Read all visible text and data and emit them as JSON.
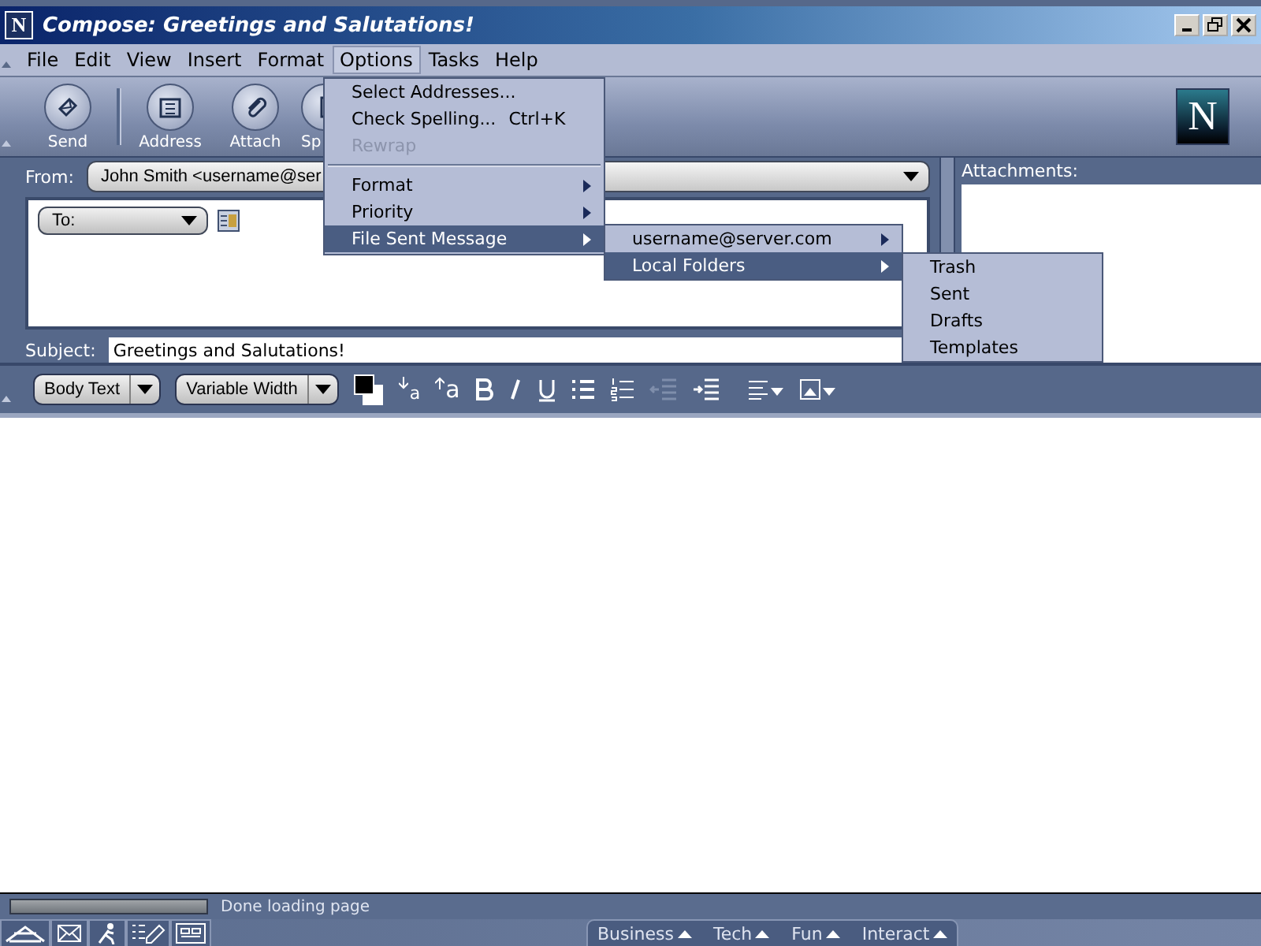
{
  "window": {
    "title": "Compose: Greetings and Salutations!",
    "logo_text": "N"
  },
  "menu_bar": [
    {
      "label": "File",
      "selected": false
    },
    {
      "label": "Edit",
      "selected": false
    },
    {
      "label": "View",
      "selected": false
    },
    {
      "label": "Insert",
      "selected": false
    },
    {
      "label": "Format",
      "selected": false
    },
    {
      "label": "Options",
      "selected": true
    },
    {
      "label": "Tasks",
      "selected": false
    },
    {
      "label": "Help",
      "selected": false
    }
  ],
  "toolbar": {
    "buttons": [
      {
        "label": "Send",
        "kind": "send"
      },
      {
        "label": "Address",
        "kind": "address"
      },
      {
        "label": "Attach",
        "kind": "attach"
      },
      {
        "label": "Sp",
        "kind": "spell"
      }
    ],
    "logo_text": "N"
  },
  "header": {
    "from_label": "From:",
    "from_value": "John Smith <username@ser",
    "to_label": "To:",
    "subject_label": "Subject:",
    "subject_value": "Greetings and Salutations!",
    "attachments_label": "Attachments:"
  },
  "format_bar": {
    "paragraph_style": "Body Text",
    "font": "Variable Width",
    "smaller_font": "a",
    "larger_font": "a"
  },
  "status_bar": {
    "text": "Done loading page",
    "level": 0
  },
  "taskbar": {
    "tabs": [
      {
        "label": "Business"
      },
      {
        "label": "Tech"
      },
      {
        "label": "Fun"
      },
      {
        "label": "Interact"
      }
    ]
  },
  "options_menu": [
    {
      "kind": "item",
      "label": "Select Addresses...",
      "disabled": false,
      "selected": false
    },
    {
      "kind": "item",
      "label": "Check Spelling...",
      "shortcut": "Ctrl+K",
      "disabled": false,
      "selected": false
    },
    {
      "kind": "item",
      "label": "Rewrap",
      "disabled": true,
      "selected": false
    },
    {
      "kind": "separator"
    },
    {
      "kind": "submenu",
      "label": "Format",
      "disabled": false,
      "selected": false
    },
    {
      "kind": "submenu",
      "label": "Priority",
      "disabled": false,
      "selected": false
    },
    {
      "kind": "submenu",
      "label": "File Sent Message",
      "disabled": false,
      "selected": true
    }
  ],
  "file_sent_menu": [
    {
      "label": "username@server.com",
      "selected": false
    },
    {
      "label": "Local Folders",
      "selected": true
    }
  ],
  "local_folders_menu": [
    {
      "label": "Trash"
    },
    {
      "label": "Sent"
    },
    {
      "label": "Drafts"
    },
    {
      "label": "Templates"
    }
  ]
}
